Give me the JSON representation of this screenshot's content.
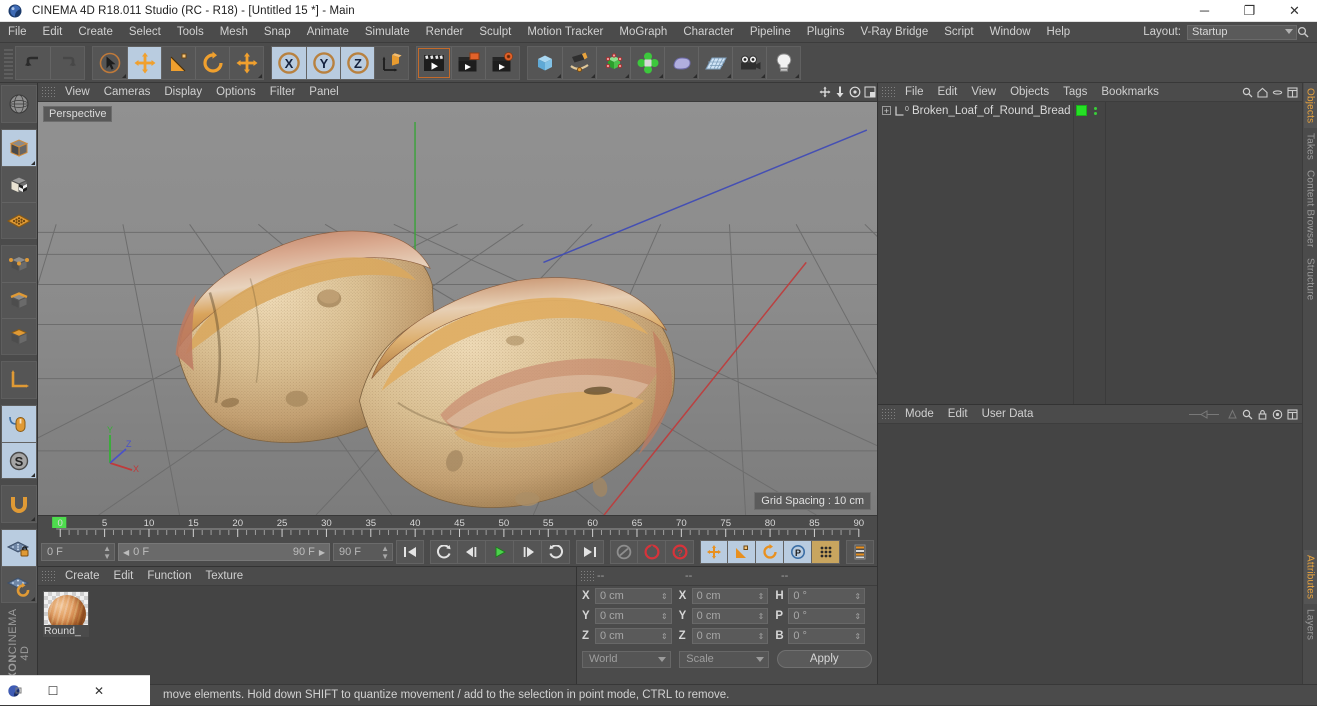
{
  "titlebar": {
    "title": "CINEMA 4D R18.011 Studio (RC - R18) - [Untitled 15 *] - Main",
    "app_icon": "cinema4d-logo-icon",
    "minimize": "─",
    "maximize": "❐",
    "close": "✕"
  },
  "menubar": {
    "items": [
      "File",
      "Edit",
      "Create",
      "Select",
      "Tools",
      "Mesh",
      "Snap",
      "Animate",
      "Simulate",
      "Render",
      "Sculpt",
      "Motion Tracker",
      "MoGraph",
      "Character",
      "Pipeline",
      "Plugins",
      "V-Ray Bridge",
      "Script",
      "Window",
      "Help"
    ],
    "layout_label": "Layout:",
    "layout_value": "Startup",
    "search_icon": "search-icon"
  },
  "toolbar": {
    "groups": [
      {
        "name": "history",
        "buttons": [
          {
            "name": "undo-button",
            "icon": "undo-arrow-icon",
            "state": "normal"
          },
          {
            "name": "redo-button",
            "icon": "redo-arrow-icon",
            "state": "disabled"
          }
        ]
      },
      {
        "name": "tools",
        "buttons": [
          {
            "name": "live-selection-tool",
            "icon": "cursor-select-icon",
            "state": "normal"
          },
          {
            "name": "move-tool",
            "icon": "move-arrows-icon",
            "state": "active"
          },
          {
            "name": "scale-tool",
            "icon": "scale-square-icon",
            "state": "normal"
          },
          {
            "name": "rotate-tool",
            "icon": "rotate-circle-icon",
            "state": "normal"
          },
          {
            "name": "move-alt-tool",
            "icon": "move-arrows-icon",
            "state": "normal"
          }
        ]
      },
      {
        "name": "axis-locks",
        "buttons": [
          {
            "name": "x-axis-lock",
            "icon": "x-axis-icon",
            "state": "active"
          },
          {
            "name": "y-axis-lock",
            "icon": "y-axis-icon",
            "state": "active"
          },
          {
            "name": "z-axis-lock",
            "icon": "z-axis-icon",
            "state": "active"
          },
          {
            "name": "world-object-coords",
            "icon": "world-axis-cube-icon",
            "state": "normal"
          }
        ]
      },
      {
        "name": "render",
        "buttons": [
          {
            "name": "render-view-button",
            "icon": "clapperboard-icon",
            "state": "normal"
          },
          {
            "name": "render-to-picture-viewer-button",
            "icon": "clapperboard-picture-icon",
            "state": "normal"
          },
          {
            "name": "render-settings-button",
            "icon": "clapperboard-gear-icon",
            "state": "normal"
          }
        ]
      },
      {
        "name": "objects",
        "buttons": [
          {
            "name": "add-cube-button",
            "icon": "blue-cube-icon",
            "state": "normal"
          },
          {
            "name": "add-spline-button",
            "icon": "pen-spline-icon",
            "state": "normal"
          },
          {
            "name": "add-generator-button",
            "icon": "green-cube-icon",
            "state": "normal"
          },
          {
            "name": "add-deformer-button",
            "icon": "green-cluster-icon",
            "state": "normal"
          },
          {
            "name": "add-scene-object-button",
            "icon": "purple-blob-icon",
            "state": "normal"
          },
          {
            "name": "add-environment-button",
            "icon": "floor-grid-icon",
            "state": "normal"
          },
          {
            "name": "add-camera-button",
            "icon": "camera-icon",
            "state": "normal"
          },
          {
            "name": "add-light-button",
            "icon": "lightbulb-icon",
            "state": "normal"
          }
        ]
      }
    ]
  },
  "left_toolbar": {
    "buttons": [
      {
        "name": "make-editable-button",
        "icon": "sphere-wire-icon",
        "state": "normal"
      },
      {
        "name": "model-mode-button",
        "icon": "model-cube-icon",
        "state": "active"
      },
      {
        "name": "texture-mode-button",
        "icon": "texture-cube-icon",
        "state": "normal"
      },
      {
        "name": "workplane-mode-button",
        "icon": "workplane-grid-icon",
        "state": "normal"
      },
      {
        "name": "points-mode-button",
        "icon": "points-cube-icon",
        "state": "normal"
      },
      {
        "name": "edges-mode-button",
        "icon": "edges-cube-icon",
        "state": "normal"
      },
      {
        "name": "polygons-mode-button",
        "icon": "polygons-cube-icon",
        "state": "normal"
      },
      {
        "name": "object-axis-button",
        "icon": "axis-l-icon",
        "state": "normal"
      },
      {
        "name": "enable-snapping-button",
        "icon": "mouse-snap-icon",
        "state": "active"
      },
      {
        "name": "soft-selection-button",
        "icon": "s-circle-icon",
        "state": "active"
      },
      {
        "name": "magnet-button",
        "icon": "magnet-icon",
        "state": "normal"
      },
      {
        "name": "workplane-lock-button",
        "icon": "grid-lock-icon",
        "state": "active"
      },
      {
        "name": "workplane-rotate-button",
        "icon": "grid-rotate-icon",
        "state": "normal"
      }
    ],
    "brand_top": "MAXON",
    "brand_bottom": "CINEMA 4D"
  },
  "viewport": {
    "menu_items": [
      "View",
      "Cameras",
      "Display",
      "Options",
      "Filter",
      "Panel"
    ],
    "corner_icons": [
      "pan-icon",
      "dolly-icon",
      "orbit-icon",
      "maximize-view-icon"
    ],
    "perspective_label": "Perspective",
    "grid_spacing_label": "Grid Spacing : 10 cm",
    "axis_gizmo": {
      "x": "X",
      "y": "Y",
      "z": "Z"
    },
    "model_name": "Broken Loaf of Round Bread"
  },
  "timeline": {
    "ticks": [
      "0",
      "5",
      "10",
      "15",
      "20",
      "25",
      "30",
      "35",
      "40",
      "45",
      "50",
      "55",
      "60",
      "65",
      "70",
      "75",
      "80",
      "85",
      "90"
    ],
    "current_frame_left": "0 F",
    "range_start": "0 F",
    "range_end": "90 F",
    "max_frame": "90 F",
    "current_frame_right": "0 F",
    "transport": [
      {
        "name": "go-to-start-button",
        "icon": "skip-back-icon"
      },
      {
        "name": "play-backward-button",
        "icon": "rewind-icon"
      },
      {
        "name": "previous-frame-button",
        "icon": "step-back-icon"
      },
      {
        "name": "play-button",
        "icon": "play-triangle-icon"
      },
      {
        "name": "next-frame-button",
        "icon": "step-forward-icon"
      },
      {
        "name": "loop-button",
        "icon": "loop-arrow-icon"
      },
      {
        "name": "go-to-end-button",
        "icon": "skip-forward-icon"
      }
    ],
    "record_group": [
      {
        "name": "autokeying-button",
        "icon": "autokey-circle-icon"
      },
      {
        "name": "record-active-objects-button",
        "icon": "record-red-circle-icon"
      },
      {
        "name": "keyframe-selection-button",
        "icon": "question-red-circle-icon"
      }
    ],
    "key_filters": [
      {
        "name": "position-key-button",
        "icon": "move-arrows-icon"
      },
      {
        "name": "scale-key-button",
        "icon": "scale-square-icon"
      },
      {
        "name": "rotation-key-button",
        "icon": "rotate-circle-icon"
      },
      {
        "name": "parameter-key-button",
        "icon": "p-circle-icon"
      },
      {
        "name": "point-level-animation-button",
        "icon": "dots-grid-icon"
      }
    ],
    "extra_button": {
      "name": "timeline-settings-button",
      "icon": "timeline-bars-icon"
    }
  },
  "material_manager": {
    "menu_items": [
      "Create",
      "Edit",
      "Function",
      "Texture"
    ],
    "materials": [
      {
        "name": "Round_",
        "swatch": "bread-sphere-preview"
      }
    ]
  },
  "coordinates": {
    "headers": [
      "--",
      "--",
      "--"
    ],
    "rows": [
      {
        "pos_label": "X",
        "pos_value": "0 cm",
        "size_label": "X",
        "size_value": "0 cm",
        "rot_label": "H",
        "rot_value": "0 °"
      },
      {
        "pos_label": "Y",
        "pos_value": "0 cm",
        "size_label": "Y",
        "size_value": "0 cm",
        "rot_label": "P",
        "rot_value": "0 °"
      },
      {
        "pos_label": "Z",
        "pos_value": "0 cm",
        "size_label": "Z",
        "size_value": "0 cm",
        "rot_label": "B",
        "rot_value": "0 °"
      }
    ],
    "coord_system": "World",
    "transform_mode": "Scale",
    "apply_label": "Apply"
  },
  "object_manager": {
    "menu_items": [
      "File",
      "Edit",
      "View",
      "Objects",
      "Tags",
      "Bookmarks"
    ],
    "header_icons": [
      "search-icon",
      "home-icon",
      "minus-icon",
      "fit-icon"
    ],
    "objects": [
      {
        "name": "Broken_Loaf_of_Round_Bread",
        "layer_badge": "0",
        "visible_dot_color": "#25e025"
      }
    ]
  },
  "attribute_manager": {
    "menu_items": [
      "Mode",
      "Edit",
      "User Data"
    ],
    "header_icons": [
      "nav-back-icon",
      "nav-forward-icon",
      "search-icon",
      "lock-icon",
      "target-icon",
      "fit-icon"
    ]
  },
  "right_tabs": [
    {
      "label": "Objects",
      "active": true
    },
    {
      "label": "Takes",
      "active": false
    },
    {
      "label": "Content Browser",
      "active": false
    },
    {
      "label": "Structure",
      "active": false
    }
  ],
  "right_tabs_lower": [
    {
      "label": "Attributes",
      "active": true
    },
    {
      "label": "Layers",
      "active": false
    }
  ],
  "statusbar": {
    "text": "move elements. Hold down SHIFT to quantize movement / add to the selection in point mode, CTRL to remove."
  },
  "taskbar_window": {
    "icon": "app-icon",
    "restore": "☐",
    "close": "✕"
  },
  "colors": {
    "accent_orange": "#e8a33d",
    "active_blue": "#b9cce0",
    "panel_bg": "#4b4b4b",
    "list_bg": "#444444",
    "viewport_bg": "#8b8b8b",
    "green_tag": "#25e025"
  }
}
